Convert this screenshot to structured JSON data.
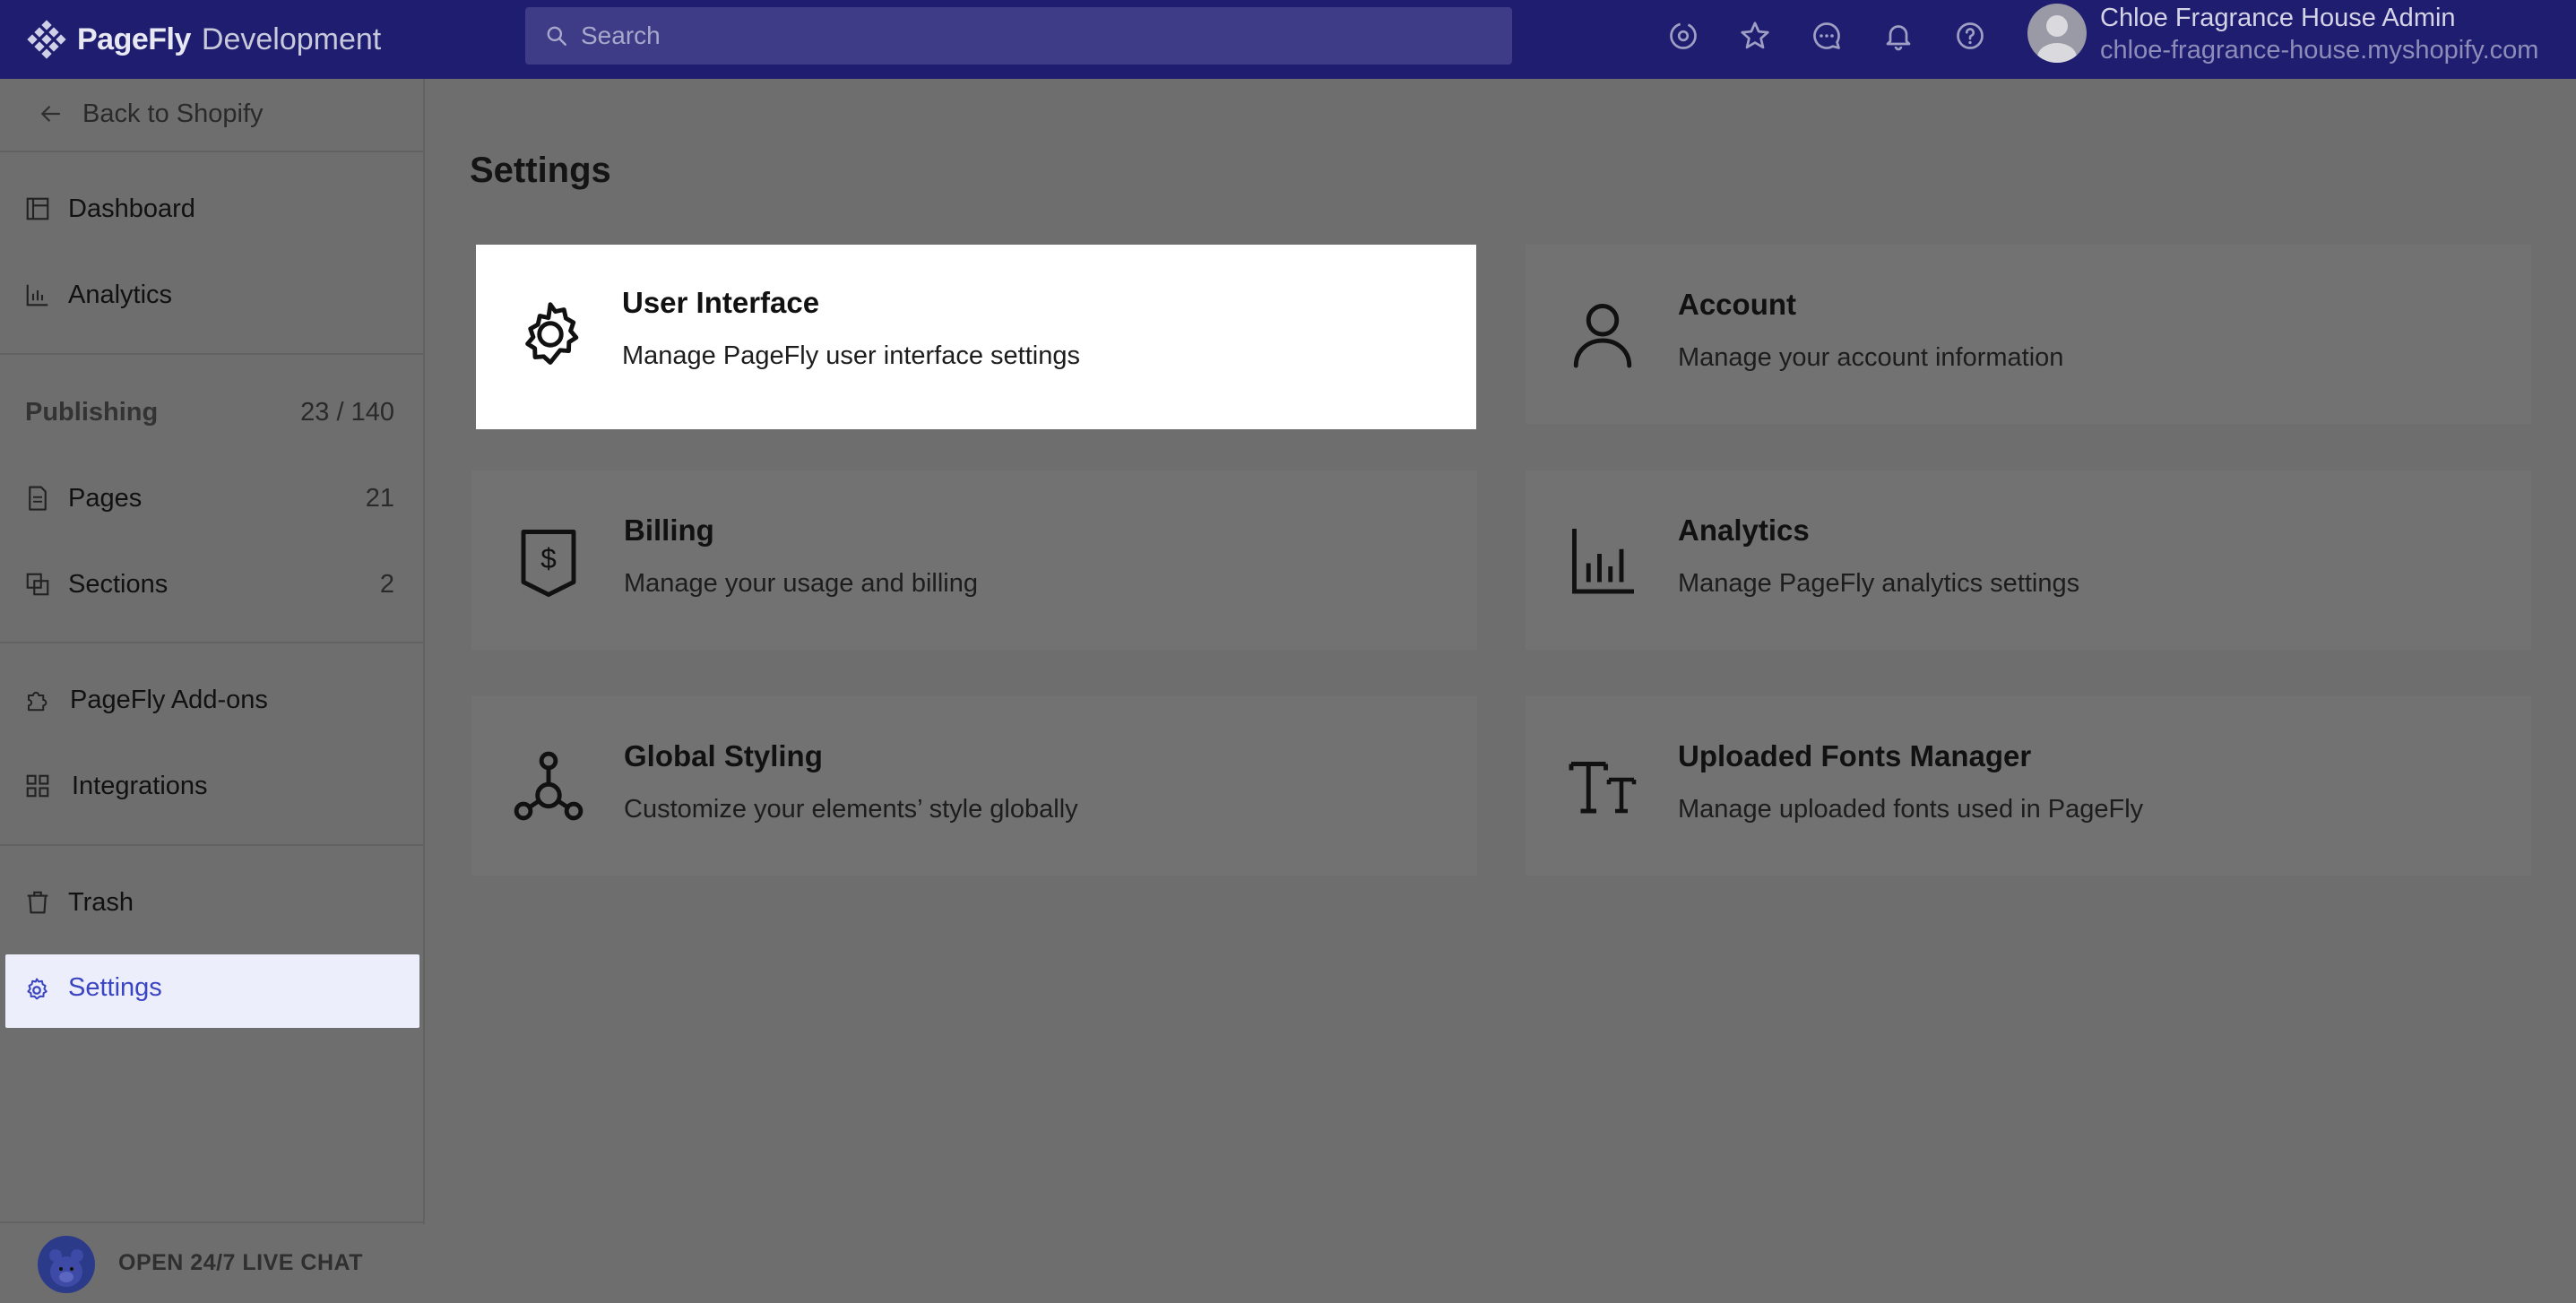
{
  "topbar": {
    "brand": "PageFly",
    "environment": "Development",
    "search_placeholder": "Search",
    "icons": [
      "settings-sync-icon",
      "star-icon",
      "chat-icon",
      "bell-icon",
      "help-icon"
    ],
    "user_name": "Chloe Fragrance House Admin",
    "user_shop": "chloe-fragrance-house.myshopify.com"
  },
  "sidebar": {
    "back_label": "Back to Shopify",
    "dashboard": "Dashboard",
    "analytics": "Analytics",
    "publishing_title": "Publishing",
    "publishing_count": "23 / 140",
    "pages": "Pages",
    "pages_count": "21",
    "sections": "Sections",
    "sections_count": "2",
    "addons": "PageFly Add-ons",
    "integrations": "Integrations",
    "trash": "Trash",
    "settings": "Settings",
    "live_chat": "OPEN 24/7 LIVE CHAT"
  },
  "main": {
    "title": "Settings",
    "cards": [
      {
        "title": "User Interface",
        "desc": "Manage PageFly user interface settings",
        "icon": "gear-icon"
      },
      {
        "title": "Account",
        "desc": "Manage your account information",
        "icon": "person-icon"
      },
      {
        "title": "Billing",
        "desc": "Manage your usage and billing",
        "icon": "dollar-tag-icon"
      },
      {
        "title": "Analytics",
        "desc": "Manage PageFly analytics settings",
        "icon": "bar-chart-icon"
      },
      {
        "title": "Global Styling",
        "desc": "Customize your elements’ style globally",
        "icon": "molecule-icon"
      },
      {
        "title": "Uploaded Fonts Manager",
        "desc": "Manage uploaded fonts used in PageFly",
        "icon": "font-size-icon"
      }
    ]
  },
  "colors": {
    "topbar_bg": "#1f1d70",
    "page_overlay": "#6e6e6f",
    "active_text": "#3b45c2",
    "active_bg": "#eceefb"
  }
}
